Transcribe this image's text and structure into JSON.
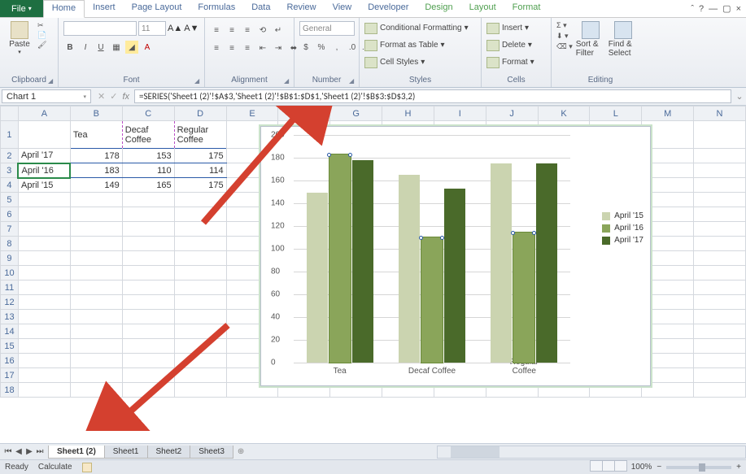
{
  "tabs": {
    "file": "File",
    "list": [
      "Home",
      "Insert",
      "Page Layout",
      "Formulas",
      "Data",
      "Review",
      "View",
      "Developer"
    ],
    "context": [
      "Design",
      "Layout",
      "Format"
    ],
    "active": "Home"
  },
  "ribbon": {
    "clipboard": {
      "title": "Clipboard",
      "paste": "Paste"
    },
    "font": {
      "title": "Font",
      "size": "11",
      "buttons": [
        "B",
        "I",
        "U"
      ]
    },
    "alignment": {
      "title": "Alignment"
    },
    "number": {
      "title": "Number",
      "format": "General"
    },
    "styles": {
      "title": "Styles",
      "cond": "Conditional Formatting",
      "table": "Format as Table",
      "cell": "Cell Styles"
    },
    "cells": {
      "title": "Cells",
      "insert": "Insert",
      "delete": "Delete",
      "format": "Format"
    },
    "editing": {
      "title": "Editing",
      "sort": "Sort & Filter",
      "find": "Find & Select"
    }
  },
  "namebox": "Chart 1",
  "formula": "=SERIES('Sheet1 (2)'!$A$3,'Sheet1 (2)'!$B$1:$D$1,'Sheet1 (2)'!$B$3:$D$3,2)",
  "columns": [
    "A",
    "B",
    "C",
    "D",
    "E",
    "F",
    "G",
    "H",
    "I",
    "J",
    "K",
    "L",
    "M",
    "N"
  ],
  "rows": 18,
  "data": {
    "headers": [
      "",
      "Tea",
      "Decaf Coffee",
      "Regular Coffee"
    ],
    "r2": [
      "April '17",
      "178",
      "153",
      "175"
    ],
    "r3": [
      "April '16",
      "183",
      "110",
      "114"
    ],
    "r4": [
      "April '15",
      "149",
      "165",
      "175"
    ]
  },
  "chart_data": {
    "type": "bar",
    "categories": [
      "Tea",
      "Decaf Coffee",
      "Regular Coffee"
    ],
    "series": [
      {
        "name": "April '15",
        "values": [
          149,
          165,
          175
        ],
        "color": "#cbd4b0"
      },
      {
        "name": "April '16",
        "values": [
          183,
          110,
          114
        ],
        "color": "#8aa55a"
      },
      {
        "name": "April '17",
        "values": [
          178,
          153,
          175
        ],
        "color": "#4a6a2a"
      }
    ],
    "ylim": [
      0,
      200
    ],
    "ystep": 20,
    "selected_series": 1
  },
  "sheet_tabs": {
    "list": [
      "Sheet1 (2)",
      "Sheet1",
      "Sheet2",
      "Sheet3"
    ],
    "active": "Sheet1 (2)"
  },
  "status": {
    "ready": "Ready",
    "calc": "Calculate",
    "zoom": "100%"
  }
}
